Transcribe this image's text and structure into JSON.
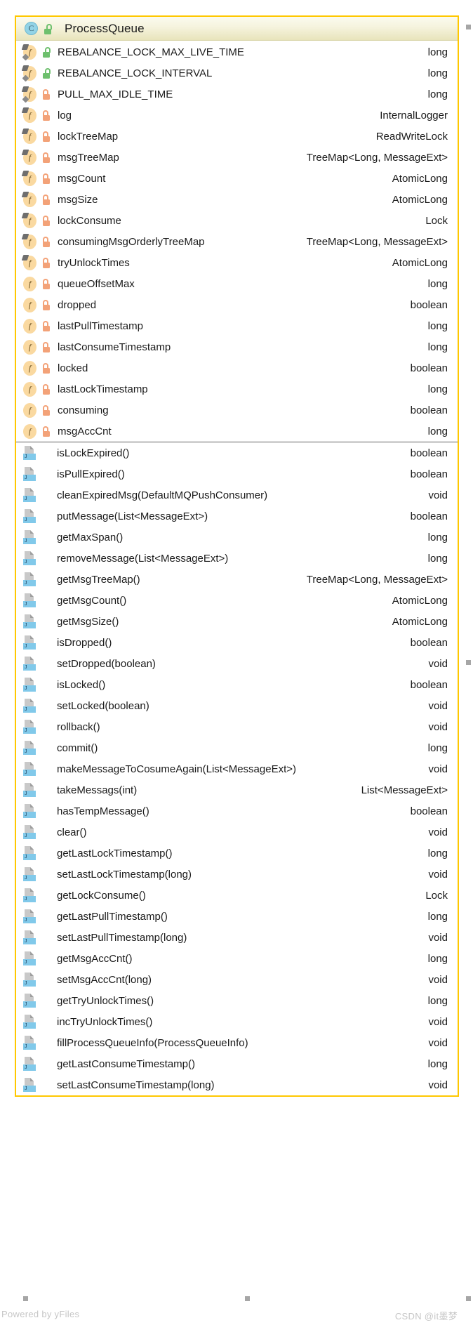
{
  "diagram": {
    "tool_watermark": "Powered by yFiles",
    "author_watermark": "CSDN @it墨梦",
    "border_color": "#ffc800",
    "header_gradient_top": "#fbfbef",
    "header_gradient_bottom": "#e8e4bb",
    "public_color": "#6ec06e",
    "private_color": "#f3a278",
    "class_icon_color": "#92d3e6",
    "field_icon_color": "#fad9a0",
    "method_icon_color": "#81c9ea"
  },
  "class_node": {
    "icon": "class-icon",
    "icon_letter": "C",
    "visibility": "public",
    "name": "ProcessQueue",
    "fields": [
      {
        "icon": "field-static-final-icon",
        "visibility": "public",
        "name": "REBALANCE_LOCK_MAX_LIVE_TIME",
        "type": "long"
      },
      {
        "icon": "field-static-final-icon",
        "visibility": "public",
        "name": "REBALANCE_LOCK_INTERVAL",
        "type": "long"
      },
      {
        "icon": "field-static-final-icon",
        "visibility": "private",
        "name": "PULL_MAX_IDLE_TIME",
        "type": "long"
      },
      {
        "icon": "field-final-icon",
        "visibility": "private",
        "name": "log",
        "type": "InternalLogger"
      },
      {
        "icon": "field-final-icon",
        "visibility": "private",
        "name": "lockTreeMap",
        "type": "ReadWriteLock"
      },
      {
        "icon": "field-final-icon",
        "visibility": "private",
        "name": "msgTreeMap",
        "type": "TreeMap<Long, MessageExt>"
      },
      {
        "icon": "field-final-icon",
        "visibility": "private",
        "name": "msgCount",
        "type": "AtomicLong"
      },
      {
        "icon": "field-final-icon",
        "visibility": "private",
        "name": "msgSize",
        "type": "AtomicLong"
      },
      {
        "icon": "field-final-icon",
        "visibility": "private",
        "name": "lockConsume",
        "type": "Lock"
      },
      {
        "icon": "field-final-icon",
        "visibility": "private",
        "name": "consumingMsgOrderlyTreeMap",
        "type": "TreeMap<Long, MessageExt>"
      },
      {
        "icon": "field-final-icon",
        "visibility": "private",
        "name": "tryUnlockTimes",
        "type": "AtomicLong"
      },
      {
        "icon": "field-icon",
        "visibility": "private",
        "name": "queueOffsetMax",
        "type": "long"
      },
      {
        "icon": "field-icon",
        "visibility": "private",
        "name": "dropped",
        "type": "boolean"
      },
      {
        "icon": "field-icon",
        "visibility": "private",
        "name": "lastPullTimestamp",
        "type": "long"
      },
      {
        "icon": "field-icon",
        "visibility": "private",
        "name": "lastConsumeTimestamp",
        "type": "long"
      },
      {
        "icon": "field-icon",
        "visibility": "private",
        "name": "locked",
        "type": "boolean"
      },
      {
        "icon": "field-icon",
        "visibility": "private",
        "name": "lastLockTimestamp",
        "type": "long"
      },
      {
        "icon": "field-icon",
        "visibility": "private",
        "name": "consuming",
        "type": "boolean"
      },
      {
        "icon": "field-icon",
        "visibility": "private",
        "name": "msgAccCnt",
        "type": "long"
      }
    ],
    "methods": [
      {
        "icon": "method-icon",
        "name": "isLockExpired()",
        "type": "boolean"
      },
      {
        "icon": "method-icon",
        "name": "isPullExpired()",
        "type": "boolean"
      },
      {
        "icon": "method-icon",
        "name": "cleanExpiredMsg(DefaultMQPushConsumer)",
        "type": "void"
      },
      {
        "icon": "method-icon",
        "name": "putMessage(List<MessageExt>)",
        "type": "boolean"
      },
      {
        "icon": "method-icon",
        "name": "getMaxSpan()",
        "type": "long"
      },
      {
        "icon": "method-icon",
        "name": "removeMessage(List<MessageExt>)",
        "type": "long"
      },
      {
        "icon": "method-icon",
        "name": "getMsgTreeMap()",
        "type": "TreeMap<Long, MessageExt>"
      },
      {
        "icon": "method-icon",
        "name": "getMsgCount()",
        "type": "AtomicLong"
      },
      {
        "icon": "method-icon",
        "name": "getMsgSize()",
        "type": "AtomicLong"
      },
      {
        "icon": "method-icon",
        "name": "isDropped()",
        "type": "boolean"
      },
      {
        "icon": "method-icon",
        "name": "setDropped(boolean)",
        "type": "void"
      },
      {
        "icon": "method-icon",
        "name": "isLocked()",
        "type": "boolean"
      },
      {
        "icon": "method-icon",
        "name": "setLocked(boolean)",
        "type": "void"
      },
      {
        "icon": "method-icon",
        "name": "rollback()",
        "type": "void"
      },
      {
        "icon": "method-icon",
        "name": "commit()",
        "type": "long"
      },
      {
        "icon": "method-icon",
        "name": "makeMessageToCosumeAgain(List<MessageExt>)",
        "type": "void"
      },
      {
        "icon": "method-icon",
        "name": "takeMessags(int)",
        "type": "List<MessageExt>"
      },
      {
        "icon": "method-icon",
        "name": "hasTempMessage()",
        "type": "boolean"
      },
      {
        "icon": "method-icon",
        "name": "clear()",
        "type": "void"
      },
      {
        "icon": "method-icon",
        "name": "getLastLockTimestamp()",
        "type": "long"
      },
      {
        "icon": "method-icon",
        "name": "setLastLockTimestamp(long)",
        "type": "void"
      },
      {
        "icon": "method-icon",
        "name": "getLockConsume()",
        "type": "Lock"
      },
      {
        "icon": "method-icon",
        "name": "getLastPullTimestamp()",
        "type": "long"
      },
      {
        "icon": "method-icon",
        "name": "setLastPullTimestamp(long)",
        "type": "void"
      },
      {
        "icon": "method-icon",
        "name": "getMsgAccCnt()",
        "type": "long"
      },
      {
        "icon": "method-icon",
        "name": "setMsgAccCnt(long)",
        "type": "void"
      },
      {
        "icon": "method-icon",
        "name": "getTryUnlockTimes()",
        "type": "long"
      },
      {
        "icon": "method-icon",
        "name": "incTryUnlockTimes()",
        "type": "void"
      },
      {
        "icon": "method-icon",
        "name": "fillProcessQueueInfo(ProcessQueueInfo)",
        "type": "void"
      },
      {
        "icon": "method-icon",
        "name": "getLastConsumeTimestamp()",
        "type": "long"
      },
      {
        "icon": "method-icon",
        "name": "setLastConsumeTimestamp(long)",
        "type": "void"
      }
    ]
  }
}
